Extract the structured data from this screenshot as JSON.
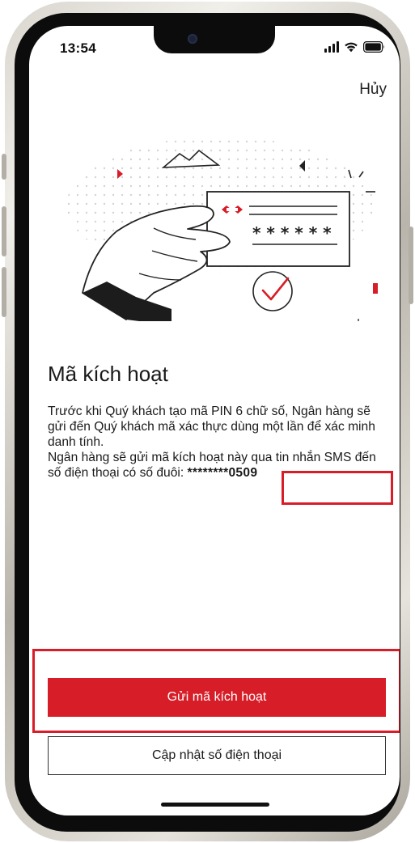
{
  "status_bar": {
    "time": "13:54",
    "signal_icon": "cellular-signal-icon",
    "wifi_icon": "wifi-icon",
    "battery_icon": "battery-icon"
  },
  "header": {
    "cancel_label": "Hủy"
  },
  "illustration": {
    "pin_mask": "* * * * * *",
    "icons": [
      "hand-icon",
      "pin-card-icon",
      "checkmark-circle-icon",
      "mountain-icon"
    ]
  },
  "content": {
    "title": "Mã kích hoạt",
    "description_1": "Trước khi Quý khách tạo mã PIN 6 chữ số, Ngân hàng sẽ gửi đến Quý khách mã xác thực dùng một lần để xác minh danh tính.",
    "description_2_prefix": "Ngân hàng sẽ gửi mã kích hoạt này qua tin nhắn SMS  đến số điện thoại có số đuôi: ",
    "masked_phone": "********0509"
  },
  "actions": {
    "send_code_label": "Gửi mã kích hoạt",
    "update_phone_label": "Cập nhật số điện thoại"
  },
  "colors": {
    "brand_red": "#d71e28",
    "text": "#1a1a1a",
    "highlight_box": "#d71e28"
  }
}
